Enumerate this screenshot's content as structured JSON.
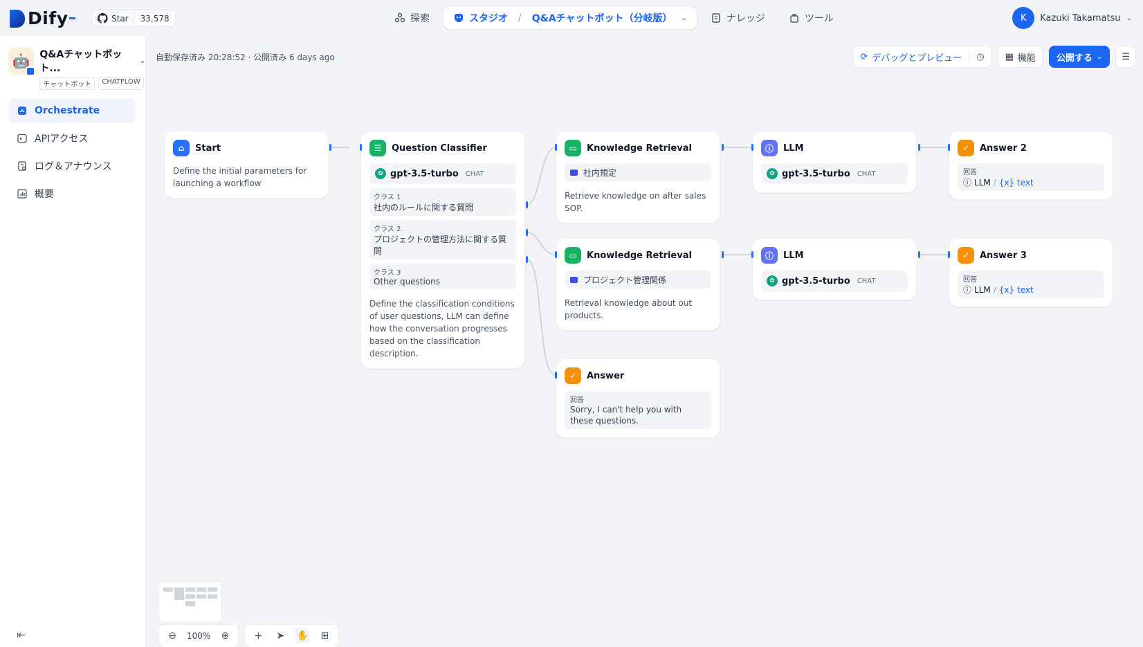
{
  "brand": {
    "name": "Dify"
  },
  "github": {
    "label": "Star",
    "count": "33,578"
  },
  "nav": {
    "explore": "探索",
    "studio": "スタジオ",
    "app_crumb": "Q&Aチャットボット（分岐版）",
    "knowledge": "ナレッジ",
    "tools": "ツール"
  },
  "user": {
    "initial": "K",
    "name": "Kazuki Takamatsu"
  },
  "app": {
    "name": "Q&Aチャットボット...",
    "tag1": "チャットボット",
    "tag2": "CHATFLOW"
  },
  "sidebar": {
    "items": [
      {
        "label": "Orchestrate"
      },
      {
        "label": "APIアクセス"
      },
      {
        "label": "ログ＆アナウンス"
      },
      {
        "label": "概要"
      }
    ]
  },
  "status": {
    "text": "自動保存済み 20:28:52 · 公開済み 6 days ago"
  },
  "toolbar": {
    "debug": "デバッグとプレビュー",
    "features": "機能",
    "publish": "公開する"
  },
  "nodes": {
    "start": {
      "title": "Start",
      "desc": "Define the initial parameters for launching a workflow"
    },
    "classifier": {
      "title": "Question Classifier",
      "model": "gpt-3.5-turbo",
      "mode": "CHAT",
      "classes": [
        {
          "label": "クラス 1",
          "text": "社内のルールに関する質問"
        },
        {
          "label": "クラス 2",
          "text": "プロジェクトの管理方法に関する質問"
        },
        {
          "label": "クラス 3",
          "text": "Other questions"
        }
      ],
      "desc": "Define the classification conditions of user questions, LLM can define how the conversation progresses based on the classification description."
    },
    "kr1": {
      "title": "Knowledge Retrieval",
      "kb": "社内規定",
      "desc": "Retrieve knowledge on after sales SOP."
    },
    "kr2": {
      "title": "Knowledge Retrieval",
      "kb": "プロジェクト管理関係",
      "desc": "Retrieval knowledge about out products."
    },
    "llm1": {
      "title": "LLM",
      "model": "gpt-3.5-turbo",
      "mode": "CHAT"
    },
    "llm2": {
      "title": "LLM",
      "model": "gpt-3.5-turbo",
      "mode": "CHAT"
    },
    "ans2": {
      "title": "Answer 2",
      "label": "回答",
      "src": "LLM",
      "var": "{x} text"
    },
    "ans3": {
      "title": "Answer 3",
      "label": "回答",
      "src": "LLM",
      "var": "{x} text"
    },
    "ans": {
      "title": "Answer",
      "label": "回答",
      "text": "Sorry, I can't help you with these questions."
    }
  },
  "zoom": {
    "level": "100%"
  },
  "colors": {
    "accent": "#1c64f2",
    "green": "#16b364",
    "purple": "#6172f3",
    "orange": "#f79009"
  }
}
